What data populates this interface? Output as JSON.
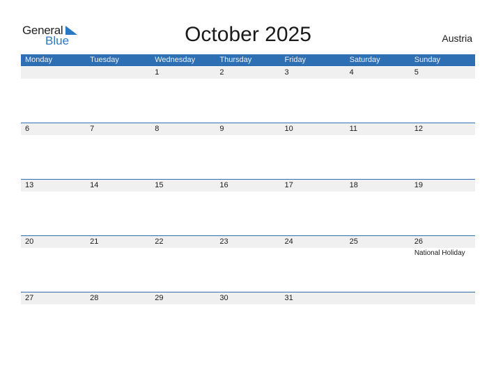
{
  "logo": {
    "part1": "General",
    "part2": "Blue"
  },
  "title": "October 2025",
  "country": "Austria",
  "colors": {
    "header_bg": "#2e6fb3",
    "logo_blue": "#2a77c2",
    "date_strip": "#f0f0f0"
  },
  "weekdays": [
    "Monday",
    "Tuesday",
    "Wednesday",
    "Thursday",
    "Friday",
    "Saturday",
    "Sunday"
  ],
  "weeks": [
    [
      "",
      "",
      "1",
      "2",
      "3",
      "4",
      "5"
    ],
    [
      "6",
      "7",
      "8",
      "9",
      "10",
      "11",
      "12"
    ],
    [
      "13",
      "14",
      "15",
      "16",
      "17",
      "18",
      "19"
    ],
    [
      "20",
      "21",
      "22",
      "23",
      "24",
      "25",
      "26"
    ],
    [
      "27",
      "28",
      "29",
      "30",
      "31",
      "",
      ""
    ]
  ],
  "holidays": [
    {
      "date": "26",
      "week": 3,
      "day": 6,
      "label": "National Holiday"
    }
  ]
}
